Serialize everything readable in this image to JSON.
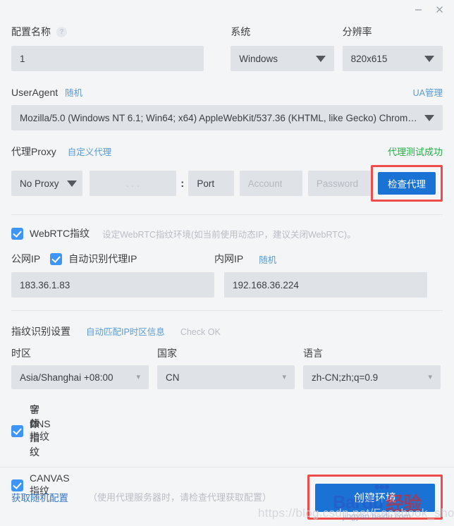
{
  "titlebar": {
    "minimize_label": "—",
    "close_label": "✕"
  },
  "profile": {
    "name_label": "配置名称",
    "help_icon": "question-mark-icon",
    "name_value": "1",
    "name_placeholder": "配置名称"
  },
  "system": {
    "label": "系统",
    "value": "Windows"
  },
  "resolution": {
    "label": "分辨率",
    "value": "820x615"
  },
  "useragent": {
    "label": "UserAgent",
    "random_link": "随机",
    "manage_link": "UA管理",
    "value": "Mozilla/5.0 (Windows NT 6.1; Win64; x64) AppleWebKit/537.36 (KHTML, like Gecko) Chrom…"
  },
  "proxy": {
    "label": "代理Proxy",
    "custom_link": "自定义代理",
    "status_text": "代理测试成功",
    "status_color": "#1fb141",
    "type_value": "No Proxy",
    "ip_placeholder": ".    .    .",
    "separator": ":",
    "port_value": "Port",
    "account_placeholder": "Account",
    "password_placeholder": "Password",
    "check_button": "检查代理",
    "highlight_color": "#ef4b4b"
  },
  "webrtc": {
    "checkbox_label": "WebRTC指纹",
    "checked": true,
    "note": "设定WebRTC指纹环境(如当前使用动态IP，建议关闭WebRTC)。",
    "public_ip_label": "公网IP",
    "auto_detect_label": "自动识别代理IP",
    "auto_detect_checked": true,
    "public_ip_value": "183.36.1.83",
    "local_ip_label": "内网IP",
    "local_ip_random_link": "随机",
    "local_ip_value": "192.168.36.224"
  },
  "fingerprint": {
    "section_label": "指纹识别设置",
    "auto_match_link": "自动匹配IP时区信息",
    "check_status": "Check OK",
    "timezone_label": "时区",
    "timezone_value": "Asia/Shanghai +08:00",
    "country_label": "国家",
    "country_value": "CN",
    "language_label": "语言",
    "language_value": "zh-CN;zh;q=0.9",
    "checkboxes": [
      {
        "label": "音频指纹",
        "checked": true
      },
      {
        "label": "字体指纹",
        "checked": true
      },
      {
        "label": "DNS指纹",
        "checked": true
      },
      {
        "label": "CANVAS指纹",
        "checked": true
      }
    ]
  },
  "footer": {
    "random_config_link": "获取随机配置",
    "note": "（使用代理服务器时，请检查代理获取配置）",
    "create_button": "创建环境"
  },
  "watermarks": {
    "baidu_brand": "Bai",
    "baidu_brand2": "du",
    "baidu_paws": "⁙",
    "baidu_jingyan": "经验",
    "baidu_url": "jingyan.baidu.com",
    "csdn_url": "https://blog.csdn.net/Facebook_shop"
  }
}
